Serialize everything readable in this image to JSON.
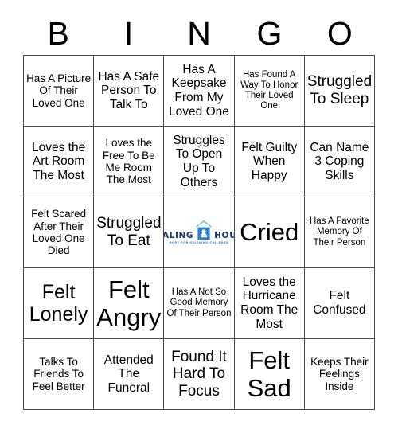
{
  "header": {
    "letters": [
      "B",
      "I",
      "N",
      "G",
      "O"
    ]
  },
  "colors": {
    "grid_line": "#4a4a4a",
    "text": "#000000",
    "logo_navy": "#1b3a6b",
    "logo_blue": "#2f7fc6",
    "logo_light_blue": "#5bb3e4",
    "background": "#ffffff"
  },
  "logo": {
    "word_left": "HEALING",
    "word_right": "HOUSE",
    "tagline": "HOPE FOR GRIEVING CHILDREN",
    "icon": "house-icon"
  },
  "grid": {
    "rows": 5,
    "columns": 5,
    "cells": [
      [
        {
          "text": "Has A Picture Of Their Loved One",
          "size": "s"
        },
        {
          "text": "Has A Safe Person To Talk To",
          "size": "m"
        },
        {
          "text": "Has A Keepsake From My Loved One",
          "size": "m"
        },
        {
          "text": "Has Found A Way To Honor Their Loved One",
          "size": "xs"
        },
        {
          "text": "Struggled To Sleep",
          "size": "l"
        }
      ],
      [
        {
          "text": "Loves the Art Room The Most",
          "size": "m"
        },
        {
          "text": "Loves the Free To Be Me Room The Most",
          "size": "s"
        },
        {
          "text": "Struggles To Open Up To Others",
          "size": "m"
        },
        {
          "text": "Felt Guilty When Happy",
          "size": "m"
        },
        {
          "text": "Can Name 3 Coping Skills",
          "size": "m"
        }
      ],
      [
        {
          "text": "Felt Scared After Their Loved One Died",
          "size": "s"
        },
        {
          "text": "Struggled To Eat",
          "size": "l"
        },
        {
          "text": "",
          "size": "logo"
        },
        {
          "text": "Cried",
          "size": "xxl"
        },
        {
          "text": "Has A Favorite Memory Of Their Person",
          "size": "xs"
        }
      ],
      [
        {
          "text": "Felt Lonely",
          "size": "xl"
        },
        {
          "text": "Felt Angry",
          "size": "xxl"
        },
        {
          "text": "Has A Not So Good Memory Of Their Person",
          "size": "xs"
        },
        {
          "text": "Loves the Hurricane Room The Most",
          "size": "m"
        },
        {
          "text": "Felt Confused",
          "size": "m"
        }
      ],
      [
        {
          "text": "Talks To Friends To Feel Better",
          "size": "s"
        },
        {
          "text": "Attended The Funeral",
          "size": "m"
        },
        {
          "text": "Found It Hard To Focus",
          "size": "l"
        },
        {
          "text": "Felt Sad",
          "size": "xxl"
        },
        {
          "text": "Keeps Their Feelings Inside",
          "size": "s"
        }
      ]
    ]
  }
}
